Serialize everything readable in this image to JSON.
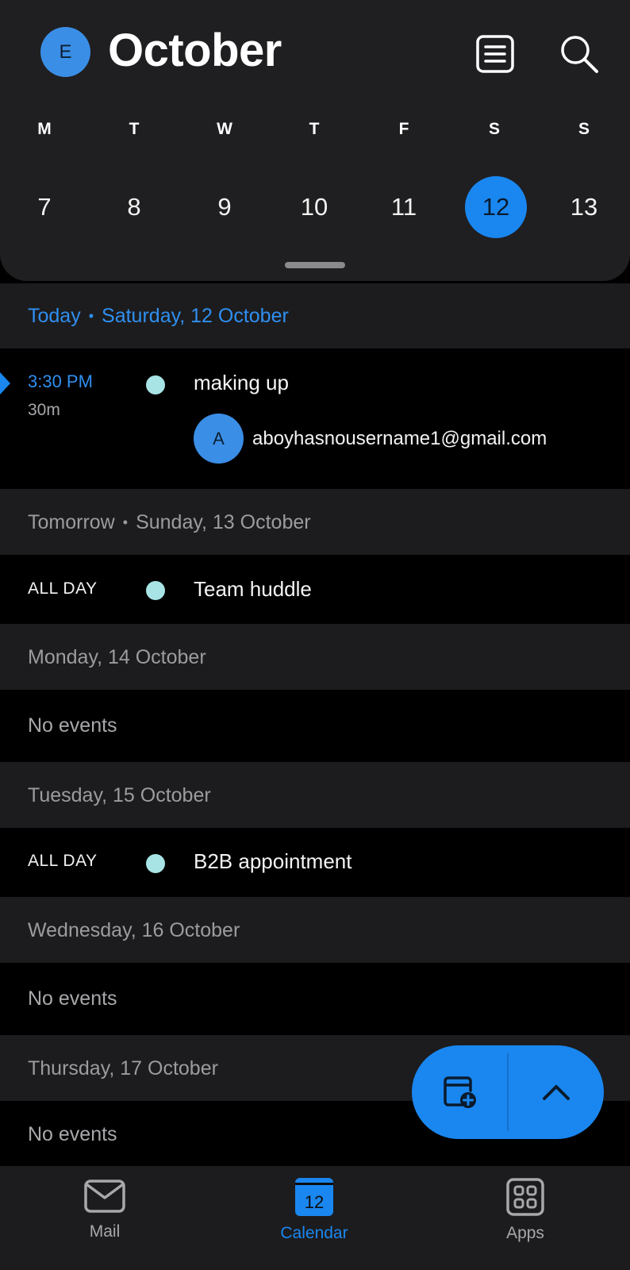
{
  "header": {
    "avatar_initial": "E",
    "month_title": "October",
    "list_icon": "list-view-icon",
    "search_icon": "search-icon"
  },
  "week": {
    "days": [
      "M",
      "T",
      "W",
      "T",
      "F",
      "S",
      "S"
    ],
    "dates": [
      "7",
      "8",
      "9",
      "10",
      "11",
      "12",
      "13"
    ],
    "selected_date": "12"
  },
  "agenda": {
    "today": {
      "label": "Today",
      "date": "Saturday, 12 October",
      "event": {
        "time": "3:30 PM",
        "duration": "30m",
        "title": "making up",
        "attendee_initial": "A",
        "attendee_email": "aboyhasnousername1@gmail.com"
      }
    },
    "tomorrow": {
      "label": "Tomorrow",
      "date": "Sunday, 13 October",
      "event": {
        "time": "ALL DAY",
        "title": "Team huddle"
      }
    },
    "mon": {
      "date": "Monday, 14 October",
      "empty": "No events"
    },
    "tue": {
      "date": "Tuesday, 15 October",
      "event": {
        "time": "ALL DAY",
        "title": "B2B appointment"
      }
    },
    "wed": {
      "date": "Wednesday, 16 October",
      "empty": "No events"
    },
    "thu": {
      "date": "Thursday, 17 October",
      "empty": "No events"
    }
  },
  "tabbar": {
    "mail": "Mail",
    "calendar": "Calendar",
    "calendar_icon_number": "12",
    "apps": "Apps"
  },
  "colors": {
    "accent": "#1a87f0",
    "event_dot": "#a8e4e6",
    "background": "#000000",
    "header_bg": "#1f1f21"
  }
}
